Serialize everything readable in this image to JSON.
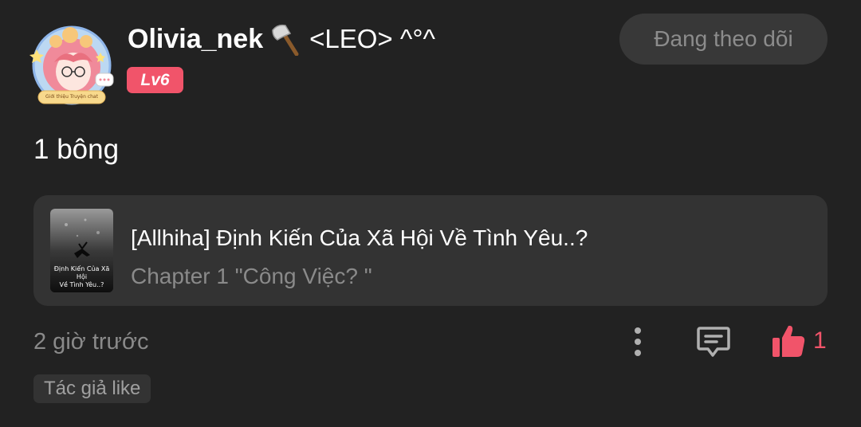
{
  "author": {
    "name": "Olivia_nek",
    "name_suffix": "<LEO> ^°^",
    "level": "Lv6",
    "avatar_frame_text": "Giới thiệu Truyện chat"
  },
  "follow_button": {
    "label": "Đang theo dõi"
  },
  "post": {
    "text": "1 bông",
    "timestamp": "2 giờ trước",
    "likes": "1",
    "author_like_label": "Tác giả like"
  },
  "story": {
    "title": "[Allhiha] Định Kiến Của Xã Hội Về Tình Yêu..?",
    "chapter": "Chapter 1 \"Công Việc? \"",
    "cover_caption_line1": "Định Kiến Của Xã Hội",
    "cover_caption_line2": "Về Tình Yêu..?"
  },
  "colors": {
    "background": "#222222",
    "card": "#333333",
    "accent": "#f1546a",
    "muted_text": "#8a8a8a"
  },
  "icons": {
    "more": "vertical-dots-icon",
    "comment": "comment-bubble-icon",
    "like": "thumbs-up-icon",
    "name_decoration": "axe-icon"
  }
}
